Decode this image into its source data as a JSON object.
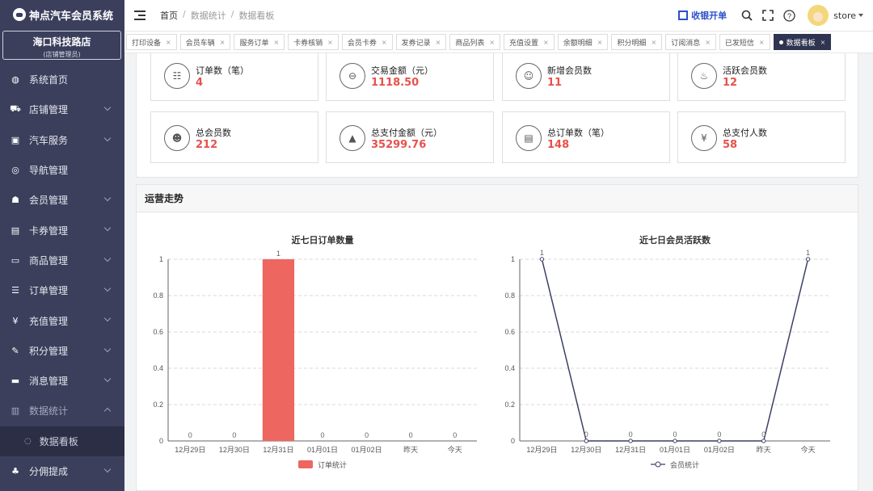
{
  "app": {
    "title": "神点汽车会员系统"
  },
  "store": {
    "name": "海口科技路店",
    "role": "(店铺管理员)"
  },
  "sidebar": {
    "items": [
      {
        "label": "系统首页",
        "icon": "dashboard-icon",
        "glyph": "◍",
        "has_chevron": false
      },
      {
        "label": "店铺管理",
        "icon": "cart-icon",
        "glyph": "⛟",
        "has_chevron": true
      },
      {
        "label": "汽车服务",
        "icon": "briefcase-icon",
        "glyph": "▣",
        "has_chevron": true
      },
      {
        "label": "导航管理",
        "icon": "check-circle-icon",
        "glyph": "◎",
        "has_chevron": false
      },
      {
        "label": "会员管理",
        "icon": "users-icon",
        "glyph": "☗",
        "has_chevron": true
      },
      {
        "label": "卡券管理",
        "icon": "ticket-icon",
        "glyph": "▤",
        "has_chevron": true
      },
      {
        "label": "商品管理",
        "icon": "monitor-icon",
        "glyph": "▭",
        "has_chevron": true
      },
      {
        "label": "订单管理",
        "icon": "list-icon",
        "glyph": "☰",
        "has_chevron": true
      },
      {
        "label": "充值管理",
        "icon": "yen-icon",
        "glyph": "¥",
        "has_chevron": true
      },
      {
        "label": "积分管理",
        "icon": "edit-icon",
        "glyph": "✎",
        "has_chevron": true
      },
      {
        "label": "消息管理",
        "icon": "message-icon",
        "glyph": "▬",
        "has_chevron": true
      },
      {
        "label": "数据统计",
        "icon": "bar-chart-icon",
        "glyph": "▥",
        "has_chevron": true,
        "expanded": true
      }
    ],
    "sub_item": {
      "label": "数据看板",
      "icon": "circle-check-icon",
      "glyph": "◌"
    },
    "last_item": {
      "label": "分佣提成",
      "icon": "sitemap-icon",
      "glyph": "♣",
      "has_chevron": true
    }
  },
  "header": {
    "breadcrumb": [
      "首页",
      "数据统计",
      "数据看板"
    ],
    "cashier_label": "收银开单",
    "username": "store"
  },
  "tabs": [
    {
      "label": "打印设备"
    },
    {
      "label": "会员车辆"
    },
    {
      "label": "服务订单"
    },
    {
      "label": "卡券核销"
    },
    {
      "label": "会员卡券"
    },
    {
      "label": "发券记录"
    },
    {
      "label": "商品列表"
    },
    {
      "label": "充值设置"
    },
    {
      "label": "余额明细"
    },
    {
      "label": "积分明细"
    },
    {
      "label": "订阅消息"
    },
    {
      "label": "已发短信"
    },
    {
      "label": "数据看板",
      "active": true
    }
  ],
  "stats": [
    {
      "label": "订单数（笔）",
      "value": "4",
      "icon": "order-icon",
      "glyph": "☷"
    },
    {
      "label": "交易金额（元）",
      "value": "1118.50",
      "icon": "scan-icon",
      "glyph": "⊖"
    },
    {
      "label": "新增会员数",
      "value": "11",
      "icon": "user-add-icon",
      "glyph": "☺"
    },
    {
      "label": "活跃会员数",
      "value": "12",
      "icon": "active-member-icon",
      "glyph": "♨"
    },
    {
      "label": "总会员数",
      "value": "212",
      "icon": "members-icon",
      "glyph": "☻"
    },
    {
      "label": "总支付金额（元）",
      "value": "35299.76",
      "icon": "growth-chart-icon",
      "glyph": "▲"
    },
    {
      "label": "总订单数（笔）",
      "value": "148",
      "icon": "document-icon",
      "glyph": "▤"
    },
    {
      "label": "总支付人数",
      "value": "58",
      "icon": "yen-circle-icon",
      "glyph": "¥"
    }
  ],
  "trend_panel": {
    "title": "运营走势"
  },
  "colors": {
    "sidebar": "#3b3f5c",
    "accent_red": "#e7514d",
    "bar": "#ee6660",
    "line": "#3c3f66",
    "active_tab": "#2f3451",
    "link_blue": "#2b50c8"
  },
  "chart_data": [
    {
      "type": "bar",
      "title": "近七日订单数量",
      "categories": [
        "12月29日",
        "12月30日",
        "12月31日",
        "01月01日",
        "01月02日",
        "昨天",
        "今天"
      ],
      "series": [
        {
          "name": "订单统计",
          "values": [
            0,
            0,
            1,
            0,
            0,
            0,
            0
          ]
        }
      ],
      "ylim": [
        0,
        1
      ],
      "yticks": [
        "0",
        "0.2",
        "0.4",
        "0.6",
        "0.8",
        "1"
      ],
      "grid": true,
      "legend": "bottom"
    },
    {
      "type": "line",
      "title": "近七日会员活跃数",
      "categories": [
        "12月29日",
        "12月30日",
        "12月31日",
        "01月01日",
        "01月02日",
        "昨天",
        "今天"
      ],
      "series": [
        {
          "name": "会员统计",
          "values": [
            1,
            0,
            0,
            0,
            0,
            0,
            1
          ]
        }
      ],
      "ylim": [
        0,
        1
      ],
      "yticks": [
        "0",
        "0.2",
        "0.4",
        "0.6",
        "0.8",
        "1"
      ],
      "grid": true,
      "legend": "bottom"
    }
  ]
}
